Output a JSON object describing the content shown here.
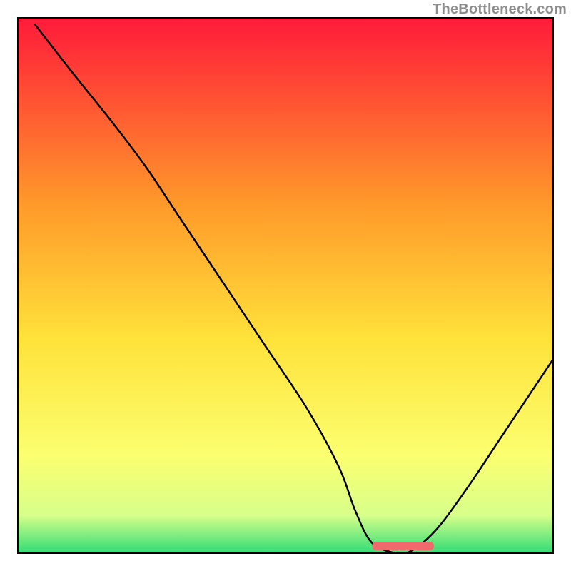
{
  "watermark": "TheBottleneck.com",
  "colors": {
    "top": "#ff1b3a",
    "mid_upper": "#ff9a2a",
    "mid": "#ffe23a",
    "mid_lower": "#fbff70",
    "near_bottom": "#d8ff8a",
    "bottom": "#33dd77",
    "nub": "#f06a6d"
  },
  "chart_data": {
    "type": "line",
    "title": "",
    "xlabel": "",
    "ylabel": "",
    "xlim": [
      0,
      1
    ],
    "ylim": [
      0,
      1
    ],
    "flat_region_x": [
      0.63,
      0.73
    ],
    "nub_x": [
      0.67,
      0.77
    ],
    "nub_y": 0.012,
    "series": [
      {
        "name": "curve",
        "x": [
          0.03,
          0.1,
          0.18,
          0.24,
          0.3,
          0.38,
          0.46,
          0.54,
          0.6,
          0.63,
          0.66,
          0.7,
          0.73,
          0.78,
          0.84,
          0.9,
          0.96,
          1.0
        ],
        "y": [
          0.99,
          0.9,
          0.8,
          0.72,
          0.63,
          0.51,
          0.39,
          0.27,
          0.16,
          0.08,
          0.02,
          0.0,
          0.0,
          0.04,
          0.12,
          0.21,
          0.3,
          0.36
        ]
      }
    ]
  }
}
